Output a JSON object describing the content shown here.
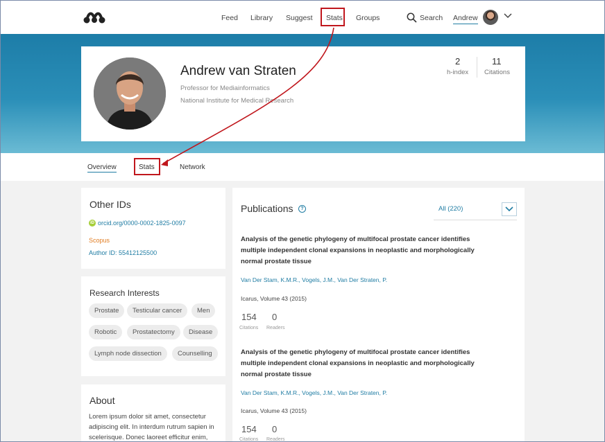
{
  "nav": {
    "links": [
      "Feed",
      "Library",
      "Suggest",
      "Stats",
      "Groups"
    ],
    "search_label": "Search",
    "user_name": "Andrew"
  },
  "profile": {
    "name": "Andrew van Straten",
    "title": "Professor for Mediainformatics",
    "institution": "National Institute for Medical Research",
    "metrics": [
      {
        "value": "2",
        "label": "h-index"
      },
      {
        "value": "11",
        "label": "Citations"
      }
    ]
  },
  "tabs": [
    "Overview",
    "Stats",
    "Network"
  ],
  "other_ids": {
    "heading": "Other IDs",
    "orcid": "orcid.org/0000-0002-1825-0097",
    "scopus_label": "Scopus",
    "author_id": "Author ID: 55412125500"
  },
  "interests": {
    "heading": "Research Interests",
    "tags": [
      "Prostate",
      "Testicular cancer",
      "Men",
      "Robotic",
      "Prostatectomy",
      "Disease",
      "Lymph node dissection",
      "Counselling"
    ]
  },
  "about": {
    "heading": "About",
    "text": "Lorem ipsum dolor sit amet, consectetur adipiscing elit. In interdum rutrum sapien in scelerisque. Donec laoreet efficitur enim,"
  },
  "publications": {
    "heading": "Publications",
    "filter": "All (220)",
    "items": [
      {
        "title": "Analysis of the genetic phylogeny of multifocal prostate cancer identifies multiple independent clonal expansions in neoplastic and morphologically normal prostate tissue",
        "authors": "Van Der Stam, K.M.R., Vogels, J.M., Van Der Straten, P.",
        "journal": "Icarus, Volume 43 (2015)",
        "citations": "154",
        "citations_label": "Citations",
        "readers": "0",
        "readers_label": "Readers"
      },
      {
        "title": "Analysis of the genetic phylogeny of multifocal prostate cancer identifies multiple independent clonal expansions in neoplastic and morphologically normal prostate tissue",
        "authors": "Van Der Stam, K.M.R., Vogels, J.M., Van Der Straten, P.",
        "journal": "Icarus, Volume 43 (2015)",
        "citations": "154",
        "citations_label": "Citations",
        "readers": "0",
        "readers_label": "Readers"
      }
    ]
  },
  "colors": {
    "accent": "#1f7ca3",
    "annotation": "#c0161c",
    "scopus": "#e07c22",
    "orcid": "#a6ce39"
  }
}
